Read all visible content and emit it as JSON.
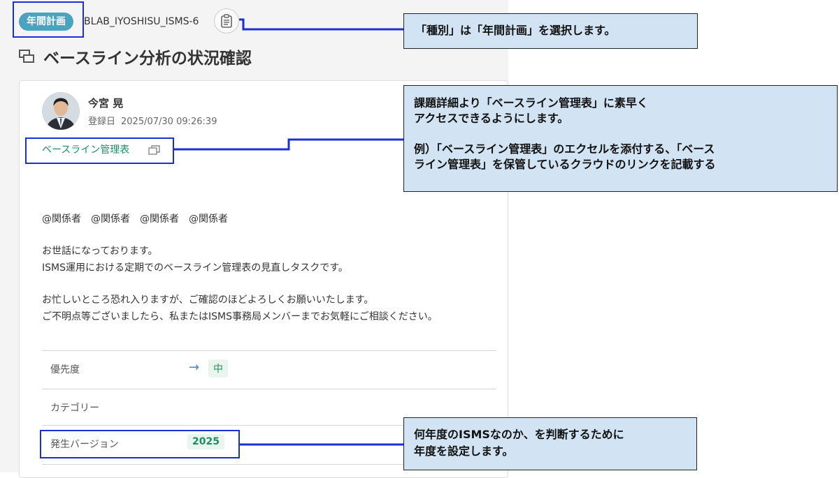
{
  "issue": {
    "type_badge": "年間計画",
    "key": "BLAB_IYOSHISU_ISMS-6",
    "summary": "ベースライン分析の状況確認"
  },
  "comment": {
    "author": "今宮 晃",
    "registered_label": "登録日",
    "registered_at": "2025/07/30 09:26:39",
    "link_text": "ベースライン管理表",
    "mentions": "@関係者　@関係者　@関係者　@関係者",
    "body_1": "お世話になっております。",
    "body_2": "ISMS運用における定期でのベースライン管理表の見直しタスクです。",
    "body_3": "お忙しいところ恐れ入りますが、ご確認のほどよろしくお願いいたします。",
    "body_4": "ご不明点等ございましたら、私またはISMS事務局メンバーまでお気軽にご相談ください。"
  },
  "attributes": {
    "priority_label": "優先度",
    "priority_value": "中",
    "category_label": "カテゴリー",
    "version_label": "発生バージョン",
    "version_value": "2025"
  },
  "callouts": {
    "type": "「種別」は「年間計画」を選択します。",
    "link_line1": "課題詳細より「ベースライン管理表」に素早く",
    "link_line2": "アクセスできるようにします。",
    "link_line3": "例）「ベースライン管理表」のエクセルを添付する、「ベース",
    "link_line4": "ライン管理表」を保管しているクラウドのリンクを記載する",
    "version_line1": "何年度のISMSなのか、を判断するために",
    "version_line2": "年度を設定します。"
  },
  "icons": {
    "copy": "clipboard-icon",
    "summary": "issue-icon",
    "external": "copy-link-icon",
    "priority": "arrow-right-icon"
  },
  "colors": {
    "badge": "#4aa3bf",
    "link": "#1a8f6a",
    "highlight": "#1b2fd6",
    "callout_bg": "#d2e4f3"
  }
}
